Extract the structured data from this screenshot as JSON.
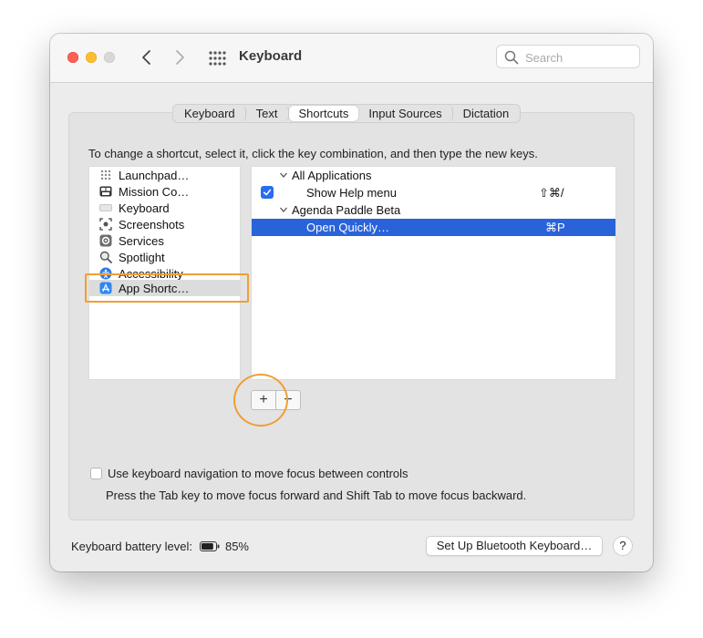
{
  "window": {
    "title": "Keyboard"
  },
  "search": {
    "placeholder": "Search"
  },
  "tabs": [
    {
      "label": "Keyboard"
    },
    {
      "label": "Text"
    },
    {
      "label": "Shortcuts",
      "active": true
    },
    {
      "label": "Input Sources"
    },
    {
      "label": "Dictation"
    }
  ],
  "instructions": "To change a shortcut, select it, click the key combination, and then type the new keys.",
  "categories": [
    {
      "label": "Launchpad…",
      "icon": "launchpad-icon"
    },
    {
      "label": "Mission Co…",
      "icon": "mission-control-icon"
    },
    {
      "label": "Keyboard",
      "icon": "keyboard-icon"
    },
    {
      "label": "Screenshots",
      "icon": "screenshot-icon"
    },
    {
      "label": "Services",
      "icon": "gear-icon"
    },
    {
      "label": "Spotlight",
      "icon": "magnifier-icon"
    },
    {
      "label": "Accessibility",
      "icon": "accessibility-icon"
    },
    {
      "label": "App Shortc…",
      "icon": "app-store-icon",
      "selected": true
    }
  ],
  "shortcuts": [
    {
      "type": "group",
      "label": "All Applications"
    },
    {
      "type": "item",
      "label": "Show Help menu",
      "key": "⇧⌘/",
      "checked": true
    },
    {
      "type": "group",
      "label": "Agenda Paddle Beta"
    },
    {
      "type": "item",
      "label": "Open Quickly…",
      "key": "⌘P",
      "selected": true
    }
  ],
  "buttons": {
    "add": "+",
    "remove": "−",
    "bluetooth": "Set Up Bluetooth Keyboard…",
    "help": "?"
  },
  "keyboard_nav": {
    "label": "Use keyboard navigation to move focus between controls",
    "checked": false,
    "note": "Press the Tab key to move focus forward and Shift Tab to move focus backward."
  },
  "battery": {
    "label": "Keyboard battery level:",
    "value": "85%",
    "level": 0.85
  },
  "colors": {
    "selection": "#2a63d9",
    "annotation": "#ef9f35",
    "checkbox": "#2a6cf2"
  }
}
